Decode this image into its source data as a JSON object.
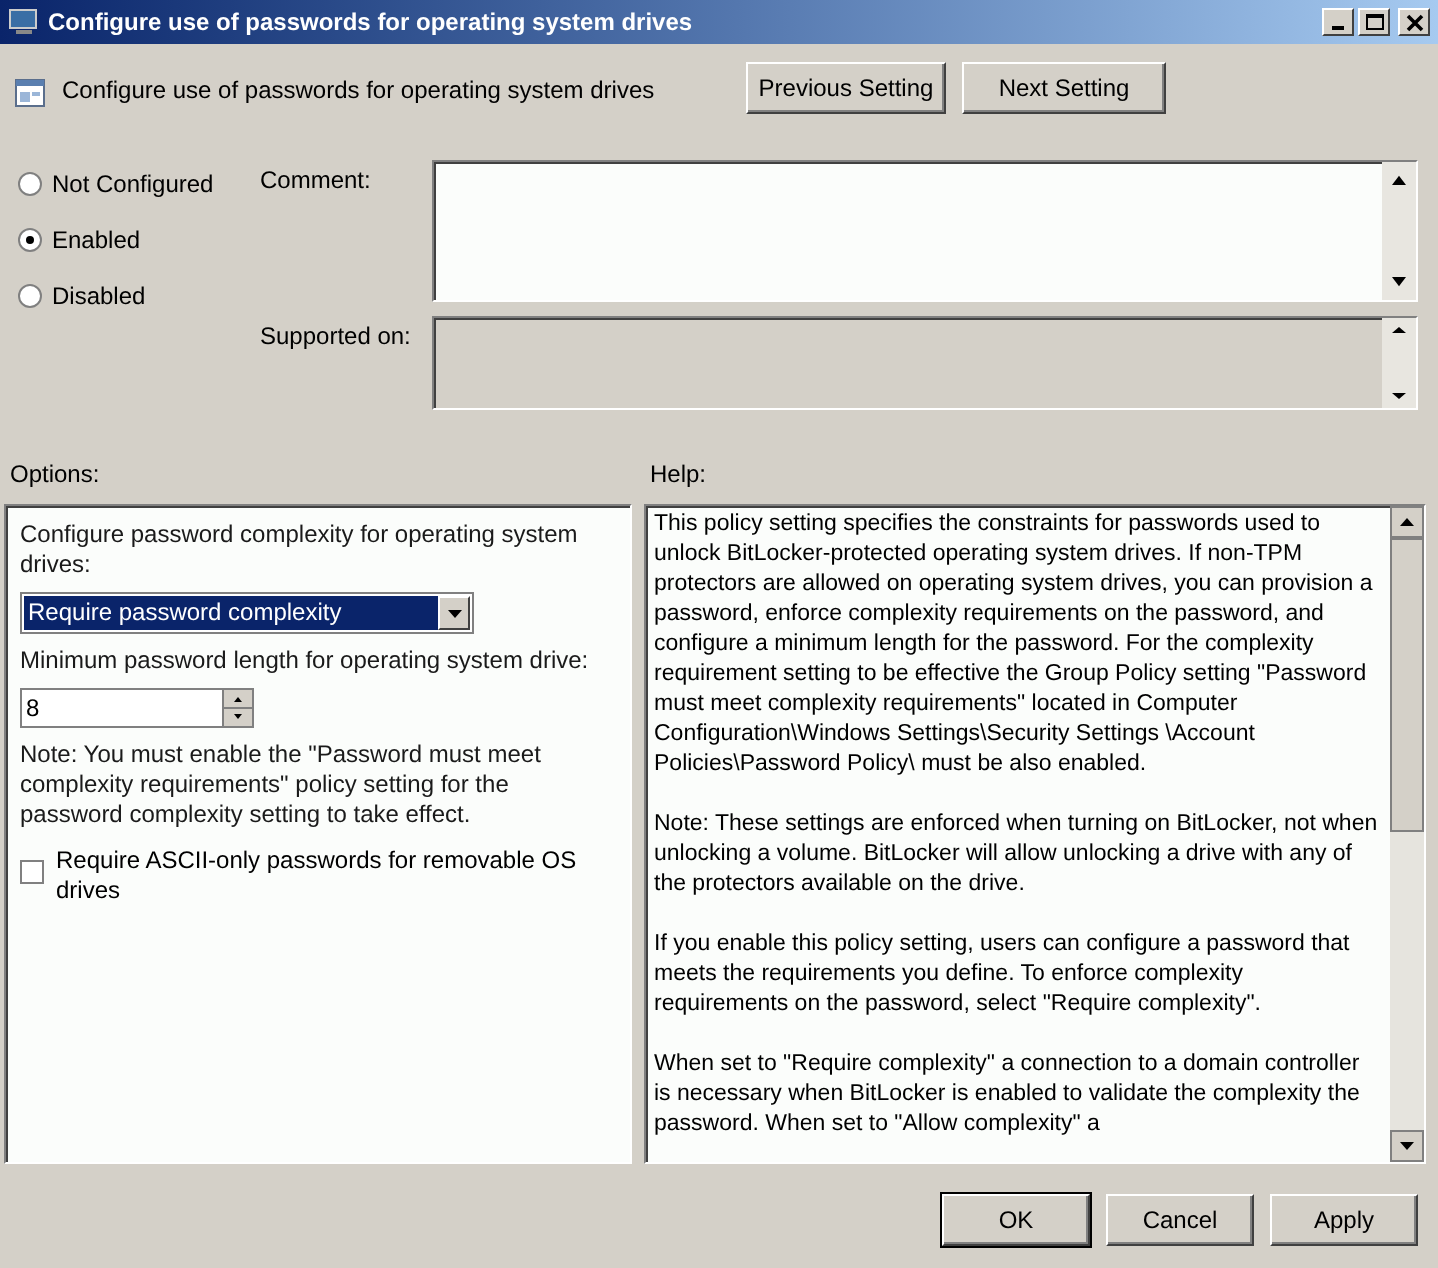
{
  "window": {
    "title": "Configure use of passwords for operating system drives"
  },
  "header": {
    "title": "Configure use of passwords for operating system drives",
    "buttons": [
      "Previous Setting",
      "Next Setting"
    ]
  },
  "state_options": [
    {
      "label": "Not Configured",
      "selected": false
    },
    {
      "label": "Enabled",
      "selected": true
    },
    {
      "label": "Disabled",
      "selected": false
    }
  ],
  "comment": {
    "label": "Comment:"
  },
  "supported_on": {
    "label": "Supported on:"
  },
  "options": {
    "label": "Options:",
    "items": [
      {
        "kind": "label",
        "text": "Configure password complexity for operating system drives:"
      },
      {
        "kind": "dropdown",
        "value": "Require password complexity"
      },
      {
        "kind": "label",
        "text": "Minimum password length for operating system drive:"
      },
      {
        "kind": "spinner",
        "value": "8"
      },
      {
        "kind": "label",
        "text": "Note: You must enable the \"Password must meet complexity requirements\" policy setting for the password complexity setting to take effect."
      },
      {
        "kind": "checkbox",
        "text": "Require ASCII-only passwords for removable OS drives",
        "checked": false
      }
    ]
  },
  "help": {
    "label": "Help:",
    "paragraphs": [
      "This policy setting specifies the constraints for passwords used to unlock BitLocker-protected operating system drives. If non-TPM protectors are allowed on operating system drives, you can provision a password, enforce complexity requirements on the password, and configure a minimum length for the password. For the complexity requirement setting to be effective the Group Policy setting \"Password must meet complexity requirements\" located in Computer Configuration\\Windows Settings\\Security Settings \\Account Policies\\Password Policy\\ must be also enabled.",
      "Note: These settings are enforced when turning on BitLocker, not when unlocking a volume. BitLocker will allow unlocking a drive with any of the protectors available on the drive.",
      "If you enable this policy setting, users can configure a password that meets the requirements you define. To enforce complexity requirements on the password, select \"Require complexity\".",
      "When set to \"Require complexity\" a connection to a domain controller is necessary when BitLocker is enabled to validate the complexity the password. When set to \"Allow complexity\" a"
    ]
  },
  "buttons": [
    "OK",
    "Cancel",
    "Apply"
  ]
}
